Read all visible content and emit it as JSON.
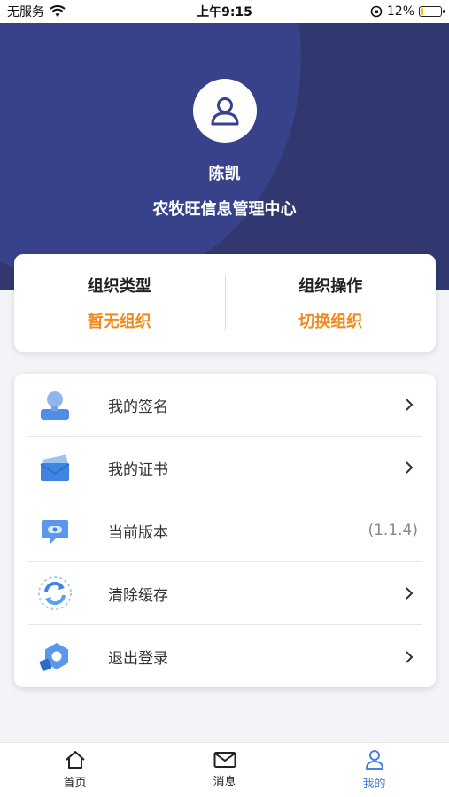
{
  "status_bar": {
    "carrier": "无服务",
    "time": "上午9:15",
    "battery_percent": "12%",
    "battery_level": 0.12
  },
  "profile": {
    "name": "陈凯",
    "organization": "农牧旺信息管理中心"
  },
  "org_card": {
    "type_title": "组织类型",
    "type_value": "暂无组织",
    "action_title": "组织操作",
    "action_value": "切换组织"
  },
  "menu": {
    "items": [
      {
        "label": "我的签名",
        "icon": "signature-person-icon"
      },
      {
        "label": "我的证书",
        "icon": "certificate-envelope-icon"
      },
      {
        "label": "当前版本",
        "icon": "version-screen-icon",
        "value": "(1.1.4)"
      },
      {
        "label": "清除缓存",
        "icon": "refresh-cache-icon"
      },
      {
        "label": "退出登录",
        "icon": "logout-hexagon-icon"
      }
    ]
  },
  "tabs": [
    {
      "label": "首页",
      "icon": "home-icon"
    },
    {
      "label": "消息",
      "icon": "mail-icon"
    },
    {
      "label": "我的",
      "icon": "user-icon",
      "active": true
    }
  ],
  "colors": {
    "header_bg": "#30386f",
    "accent_orange": "#f08a1c",
    "tab_active": "#4a7fe0"
  }
}
